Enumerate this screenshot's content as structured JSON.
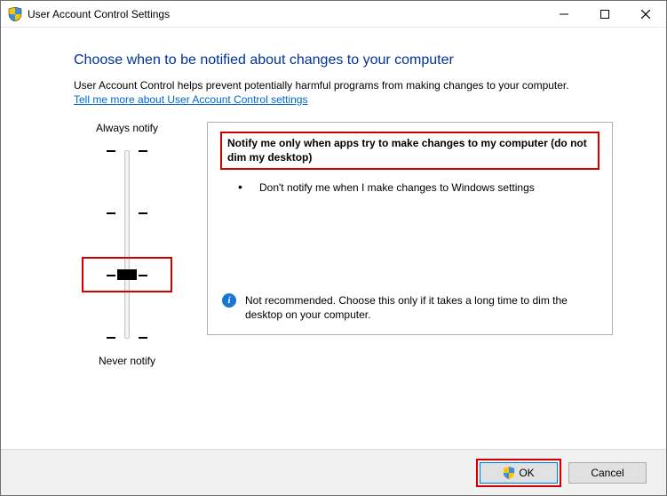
{
  "window": {
    "title": "User Account Control Settings"
  },
  "content": {
    "heading": "Choose when to be notified about changes to your computer",
    "intro": "User Account Control helps prevent potentially harmful programs from making changes to your computer.",
    "help_link": "Tell me more about User Account Control settings"
  },
  "slider": {
    "top_label": "Always notify",
    "bottom_label": "Never notify",
    "levels": 4,
    "selected_index": 2
  },
  "panel": {
    "heading": "Notify me only when apps try to make changes to my computer (do not dim my desktop)",
    "bullets": [
      "Don't notify me when I make changes to Windows settings"
    ],
    "footer_text": "Not recommended. Choose this only if it takes a long time to dim the desktop on your computer."
  },
  "buttons": {
    "ok": "OK",
    "cancel": "Cancel"
  },
  "highlights": {
    "thumb": true,
    "panel_heading": true,
    "ok_button": true
  }
}
